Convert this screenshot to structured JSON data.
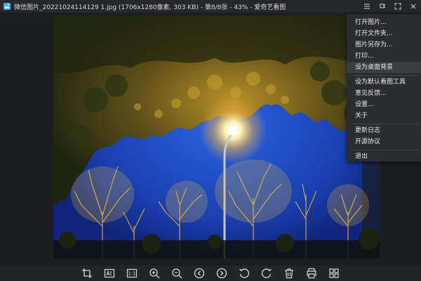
{
  "window": {
    "title": "微信图片_20221024114129 1.jpg (1706x1280像素, 303 KB) - 第8/8张 - 43% - 爱奇艺看图",
    "icons": [
      "app-logo-icon",
      "hamburger-menu-icon",
      "pin-icon",
      "fullscreen-icon",
      "close-icon"
    ]
  },
  "context_menu": {
    "items": [
      {
        "label": "打开图片..."
      },
      {
        "label": "打开文件夹..."
      },
      {
        "label": "图片另存为..."
      },
      {
        "label": "打印..."
      },
      {
        "label": "设为桌面背景"
      },
      {
        "label": "设为默认看图工具"
      },
      {
        "label": "意见反馈..."
      },
      {
        "label": "设置..."
      },
      {
        "label": "关于"
      },
      {
        "label": "更新日志"
      },
      {
        "label": "开源协议"
      },
      {
        "label": "退出"
      }
    ],
    "highlighted_index": 4
  },
  "toolbar": {
    "ratio_label": "1:1",
    "icons": [
      "crop-icon",
      "text-recognize-icon",
      "actual-size-icon",
      "zoom-in-icon",
      "zoom-out-icon",
      "previous-icon",
      "next-icon",
      "rotate-left-icon",
      "rotate-right-icon",
      "delete-icon",
      "print-icon",
      "grid-view-icon"
    ]
  },
  "colors": {
    "background": "#1e1f23",
    "menu": "#2b2c30",
    "highlight": "#3b3c41",
    "accent": "#d8a24a"
  }
}
